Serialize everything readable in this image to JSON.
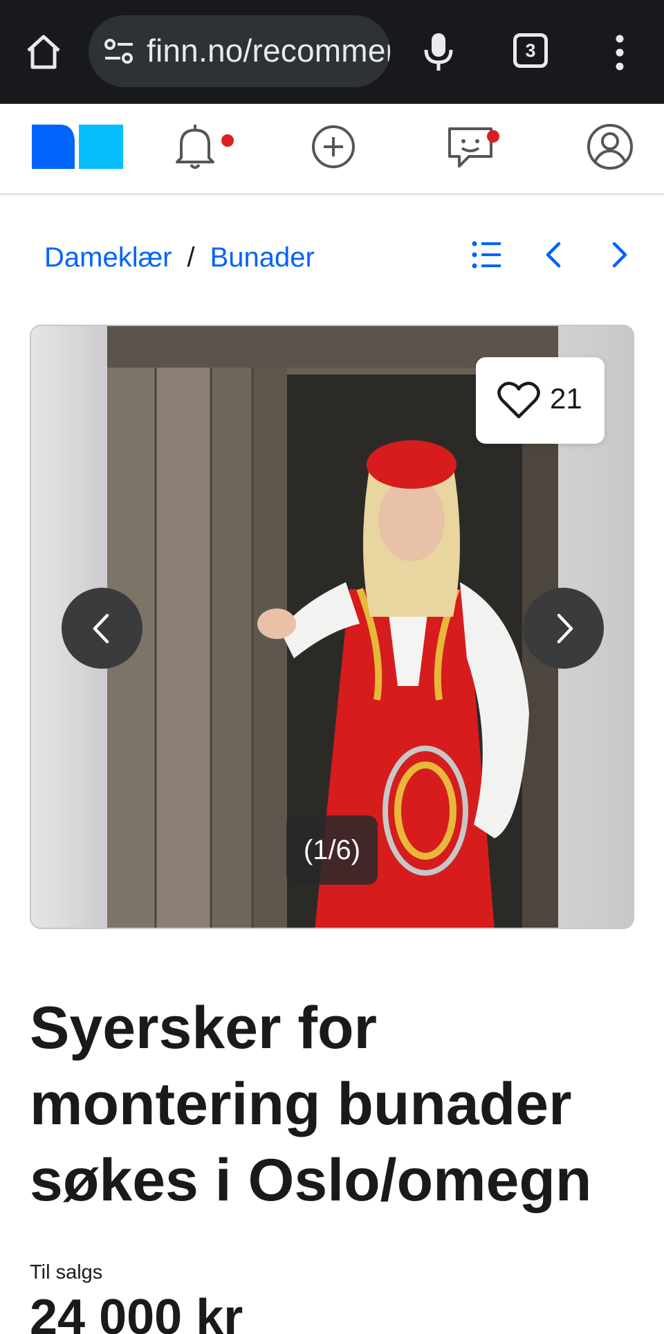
{
  "browser": {
    "url": "finn.no/recommerce/forsale/item/",
    "tab_count": "3"
  },
  "header": {
    "icons": [
      "logo",
      "bell-icon",
      "plus-circle-icon",
      "chat-icon",
      "profile-icon"
    ],
    "accent_color": "#0063fb",
    "notification_color": "#d91f1f"
  },
  "breadcrumb": {
    "items": [
      "Dameklær",
      "Bunader"
    ],
    "separator": "/"
  },
  "gallery": {
    "favorites": "21",
    "counter": "(1/6)"
  },
  "ad": {
    "title": "Syersker for montering bunader søkes i Oslo/omegn",
    "sale_label": "Til salgs",
    "price": "24 000 kr"
  }
}
